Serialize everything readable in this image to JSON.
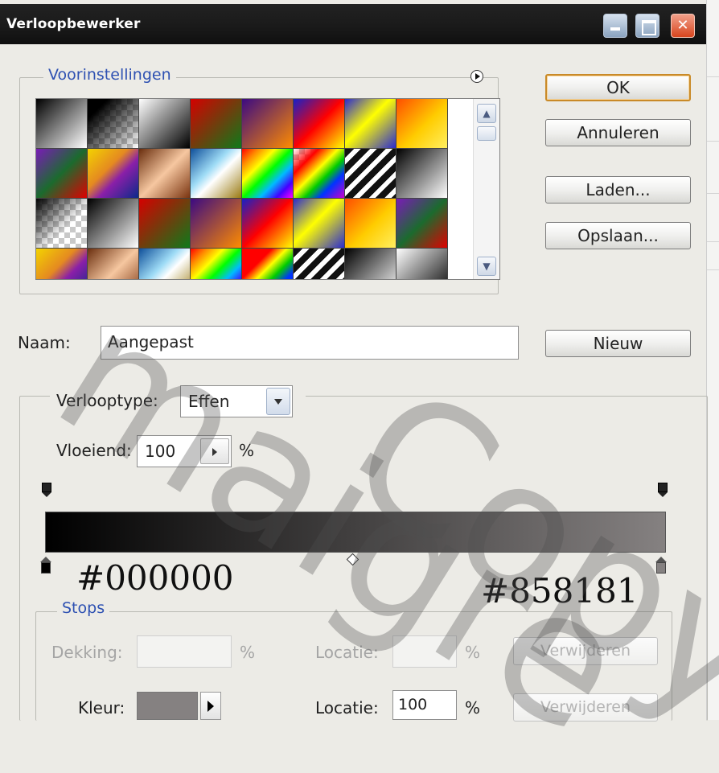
{
  "window": {
    "title": "Verloopbewerker"
  },
  "presets": {
    "legend": "Voorinstellingen",
    "swatches": [
      "linear-gradient(135deg,#000 0%,#fff 100%)",
      "linear-gradient(135deg,#000 0%,#000 20%,rgba(255,255,255,0) 100%),repeating-conic-gradient(#c8c8c8 0% 25%,#fff 0% 50%) 0 0/14px 14px",
      "linear-gradient(135deg,#fff 0%,#000 100%)",
      "linear-gradient(135deg,#d50000 0%,#0e7a1a 100%)",
      "linear-gradient(135deg,#3b0a82 0%,#ff8c00 100%)",
      "linear-gradient(135deg,#1620c8 0%,#ff0000 50%,#ffff00 100%)",
      "linear-gradient(135deg,#2a2ad0 0%,#ffff00 45%,#2a2ad0 100%)",
      "linear-gradient(135deg,#ff4d00 0%,#ffcc00 55%,#ffef60 100%)",
      "linear-gradient(135deg,#7a1bb8 0%,#1b6b2e 50%,#e00000 100%)",
      "linear-gradient(135deg,#f3d300 0%,#e58a20 40%,#8a1fa8 60%,#0b2a8a 100%)",
      "linear-gradient(135deg,#6a2e0e 0%,#f6c7a0 50%,#7a3410 100%)",
      "linear-gradient(135deg,#0f4f9a 0%,#9fdcf6 40%,#fff 55%,#9a7a10 100%)",
      "linear-gradient(135deg,#ff0000,#ff8800,#ffff00,#00ff00,#00bbff,#4400ff,#ff00ff)",
      "linear-gradient(135deg,rgba(255,0,0,0.0) 0%,#ff0000 25%,#ffff00 45%,#00cc00 60%,#0033ff 75%,#cc00cc 100%),repeating-conic-gradient(#c8c8c8 0% 25%,#fff 0% 50%) 0 0/14px 14px",
      "repeating-linear-gradient(135deg,#111 0 8px,#fff 8px 14px)",
      "linear-gradient(135deg,#000 0%,#fff 100%)",
      "linear-gradient(135deg,#000 0%,rgba(255,255,255,0) 60%),repeating-conic-gradient(#c8c8c8 0% 25%,#fff 0% 50%) 0 0/14px 14px",
      "linear-gradient(135deg,#000 0%,#fff 100%)",
      "linear-gradient(135deg,#d50000 0%,#0e7a1a 100%)",
      "linear-gradient(135deg,#3b0a82 0%,#ff8c00 100%)",
      "linear-gradient(135deg,#1620c8 0%,#ff0000 50%,#ffff00 100%)",
      "linear-gradient(135deg,#2a2ad0 0%,#ffff00 45%,#2a2ad0 100%)",
      "linear-gradient(135deg,#ff4d00 0%,#ffcc00 55%,#ffef60 100%)",
      "linear-gradient(135deg,#7a1bb8 0%,#1b6b2e 50%,#e00000 100%)",
      "linear-gradient(135deg,#f3d300 0%,#e58a20 40%,#8a1fa8 60%,#0b2a8a 100%)",
      "linear-gradient(135deg,#6a2e0e 0%,#f6c7a0 50%,#7a3410 100%)",
      "linear-gradient(135deg,#0f4f9a 0%,#9fdcf6 40%,#fff 55%,#9a7a10 100%)",
      "linear-gradient(135deg,#ff0000,#ff8800,#ffff00,#00ff00,#00bbff,#4400ff,#ff00ff)",
      "linear-gradient(135deg,#ff0000 30%,#ffff00 45%,#00cc00 60%,#0033ff 75%),repeating-conic-gradient(#c8c8c8 0% 25%,#fff 0% 50%) 0 0/14px 14px",
      "repeating-linear-gradient(135deg,#111 0 8px,#fff 8px 14px)",
      "linear-gradient(135deg,#000 0%,#fff 100%)",
      "linear-gradient(135deg,#fff 0%,#000 100%)"
    ]
  },
  "buttons": {
    "ok": "OK",
    "cancel": "Annuleren",
    "load": "Laden...",
    "save": "Opslaan...",
    "new": "Nieuw"
  },
  "name": {
    "label": "Naam:",
    "value": "Aangepast"
  },
  "gradient": {
    "type_label": "Verlooptype:",
    "type_value": "Effen",
    "smooth_label": "Vloeiend:",
    "smooth_value": "100",
    "smooth_unit": "%",
    "start_color": "#000000",
    "end_color": "#858181"
  },
  "annotations": {
    "left_hex": "#000000",
    "right_hex": "#858181"
  },
  "stops": {
    "legend": "Stops",
    "opacity_label": "Dekking:",
    "opacity_unit": "%",
    "opacity_location_label": "Locatie:",
    "opacity_location_unit": "%",
    "delete_label": "Verwijderen",
    "color_label": "Kleur:",
    "color_location_label": "Locatie:",
    "color_location_value": "100",
    "color_location_unit": "%",
    "color_delete_label": "Verwijderen"
  },
  "watermark": {
    "left": "maigre",
    "right": "Copy"
  }
}
